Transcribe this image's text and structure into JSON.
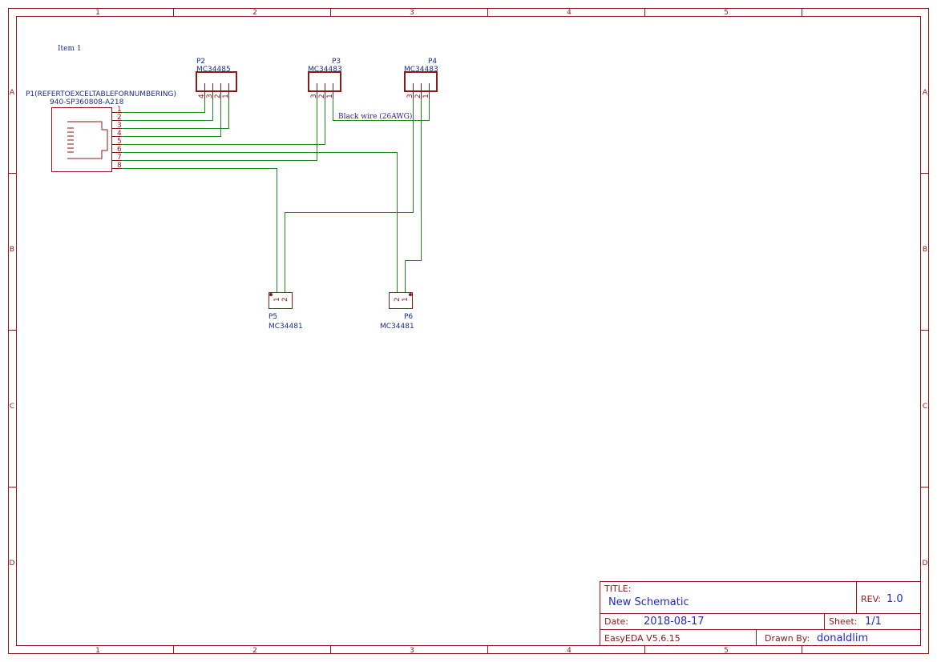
{
  "sheet": {
    "zones_cols": [
      "1",
      "2",
      "3",
      "4",
      "5"
    ],
    "zones_rows": [
      "A",
      "B",
      "C",
      "D"
    ],
    "notes": {
      "item": "Item 1",
      "wire": "Black wire (26AWG)"
    }
  },
  "components": {
    "p1": {
      "ref": "P1(REFERTOEXCELTABLEFORNUMBERING)",
      "value": "940-SP360808-A218",
      "pins": [
        "1",
        "2",
        "3",
        "4",
        "5",
        "6",
        "7",
        "8"
      ]
    },
    "p2": {
      "ref": "P2",
      "value": "MC34485",
      "pins": [
        "4",
        "3",
        "2",
        "1"
      ]
    },
    "p3": {
      "ref": "P3",
      "value": "MC34483",
      "pins": [
        "3",
        "2",
        "1"
      ]
    },
    "p4": {
      "ref": "P4",
      "value": "MC34483",
      "pins": [
        "3",
        "2",
        "1"
      ]
    },
    "p5": {
      "ref": "P5",
      "value": "MC34481",
      "pins": [
        "1",
        "2"
      ]
    },
    "p6": {
      "ref": "P6",
      "value": "MC34481",
      "pins": [
        "2",
        "1"
      ]
    }
  },
  "title_block": {
    "title_label": "TITLE:",
    "title": "New Schematic",
    "rev_label": "REV:",
    "rev": "1.0",
    "date_label": "Date:",
    "date": "2018-08-17",
    "sheet_label": "Sheet:",
    "sheet": "1/1",
    "software": "EasyEDA V5.6.15",
    "drawn_label": "Drawn By:",
    "drawn_by": "donaldlim"
  },
  "colors": {
    "frame": "#8b1a1a",
    "wire": "#1e8a1e",
    "reference_text": "#1f2a8c",
    "title_value_text": "#1f2acc"
  }
}
